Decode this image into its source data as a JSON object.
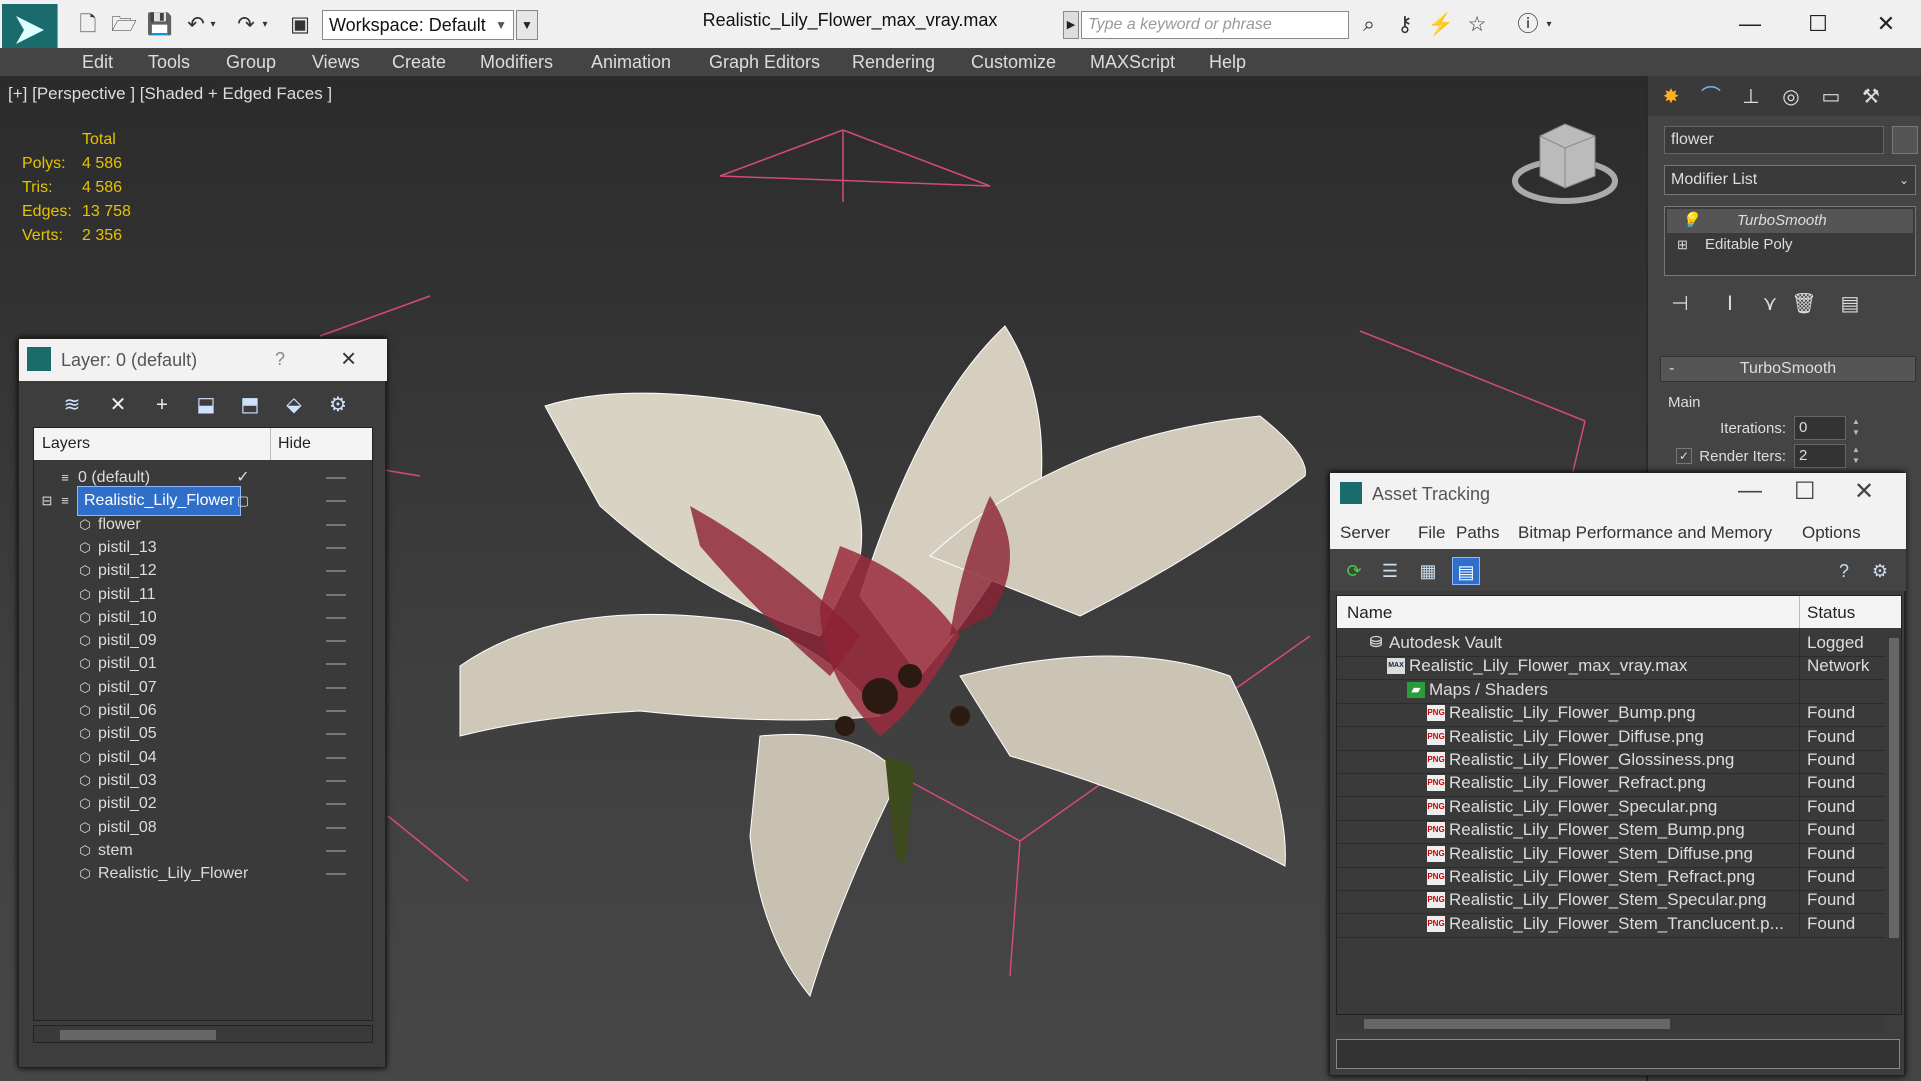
{
  "titlebar": {
    "workspace": "Workspace: Default",
    "title": "Realistic_Lily_Flower_max_vray.max",
    "search_placeholder": "Type a keyword or phrase"
  },
  "menu": [
    "Edit",
    "Tools",
    "Group",
    "Views",
    "Create",
    "Modifiers",
    "Animation",
    "Graph Editors",
    "Rendering",
    "Customize",
    "MAXScript",
    "Help"
  ],
  "viewport": {
    "label": "[+] [Perspective ] [Shaded + Edged Faces ]",
    "stats": {
      "header": "Total",
      "polys_label": "Polys:",
      "polys": "4 586",
      "tris_label": "Tris:",
      "tris": "4 586",
      "edges_label": "Edges:",
      "edges": "13 758",
      "verts_label": "Verts:",
      "verts": "2 356"
    }
  },
  "command_panel": {
    "object_name": "flower",
    "modifier_list": "Modifier List",
    "stack": [
      "TurboSmooth",
      "Editable Poly"
    ],
    "rollout_title": "TurboSmooth",
    "group_main": "Main",
    "iterations_label": "Iterations:",
    "iterations": "0",
    "render_iters_label": "Render Iters:",
    "render_iters": "2"
  },
  "layer_explorer": {
    "title": "Layer: 0 (default)",
    "help": "?",
    "col_layers": "Layers",
    "col_hide": "Hide",
    "rows": [
      {
        "label": "0 (default)"
      },
      {
        "label": "Realistic_Lily_Flower"
      },
      {
        "label": "flower"
      },
      {
        "label": "pistil_13"
      },
      {
        "label": "pistil_12"
      },
      {
        "label": "pistil_11"
      },
      {
        "label": "pistil_10"
      },
      {
        "label": "pistil_09"
      },
      {
        "label": "pistil_01"
      },
      {
        "label": "pistil_07"
      },
      {
        "label": "pistil_06"
      },
      {
        "label": "pistil_05"
      },
      {
        "label": "pistil_04"
      },
      {
        "label": "pistil_03"
      },
      {
        "label": "pistil_02"
      },
      {
        "label": "pistil_08"
      },
      {
        "label": "stem"
      },
      {
        "label": "Realistic_Lily_Flower"
      }
    ]
  },
  "asset_tracking": {
    "title": "Asset Tracking",
    "menu": [
      "Server",
      "File",
      "Paths",
      "Bitmap Performance and Memory",
      "Options"
    ],
    "col_name": "Name",
    "col_status": "Status",
    "rows": [
      {
        "name": "Autodesk Vault",
        "status": "Logged",
        "icon": "vault-icon"
      },
      {
        "name": "Realistic_Lily_Flower_max_vray.max",
        "status": "Network",
        "icon": "max-file-icon"
      },
      {
        "name": "Maps / Shaders",
        "status": "",
        "icon": "maps-folder-icon"
      },
      {
        "name": "Realistic_Lily_Flower_Bump.png",
        "status": "Found",
        "icon": "png-icon"
      },
      {
        "name": "Realistic_Lily_Flower_Diffuse.png",
        "status": "Found",
        "icon": "png-icon"
      },
      {
        "name": "Realistic_Lily_Flower_Glossiness.png",
        "status": "Found",
        "icon": "png-icon"
      },
      {
        "name": "Realistic_Lily_Flower_Refract.png",
        "status": "Found",
        "icon": "png-icon"
      },
      {
        "name": "Realistic_Lily_Flower_Specular.png",
        "status": "Found",
        "icon": "png-icon"
      },
      {
        "name": "Realistic_Lily_Flower_Stem_Bump.png",
        "status": "Found",
        "icon": "png-icon"
      },
      {
        "name": "Realistic_Lily_Flower_Stem_Diffuse.png",
        "status": "Found",
        "icon": "png-icon"
      },
      {
        "name": "Realistic_Lily_Flower_Stem_Refract.png",
        "status": "Found",
        "icon": "png-icon"
      },
      {
        "name": "Realistic_Lily_Flower_Stem_Specular.png",
        "status": "Found",
        "icon": "png-icon"
      },
      {
        "name": "Realistic_Lily_Flower_Stem_Tranclucent.p...",
        "status": "Found",
        "icon": "png-icon"
      }
    ]
  },
  "colors": {
    "accent": "#2f6fc9",
    "stats_text": "#e6c200",
    "grid_lines": "#d44a7a"
  }
}
